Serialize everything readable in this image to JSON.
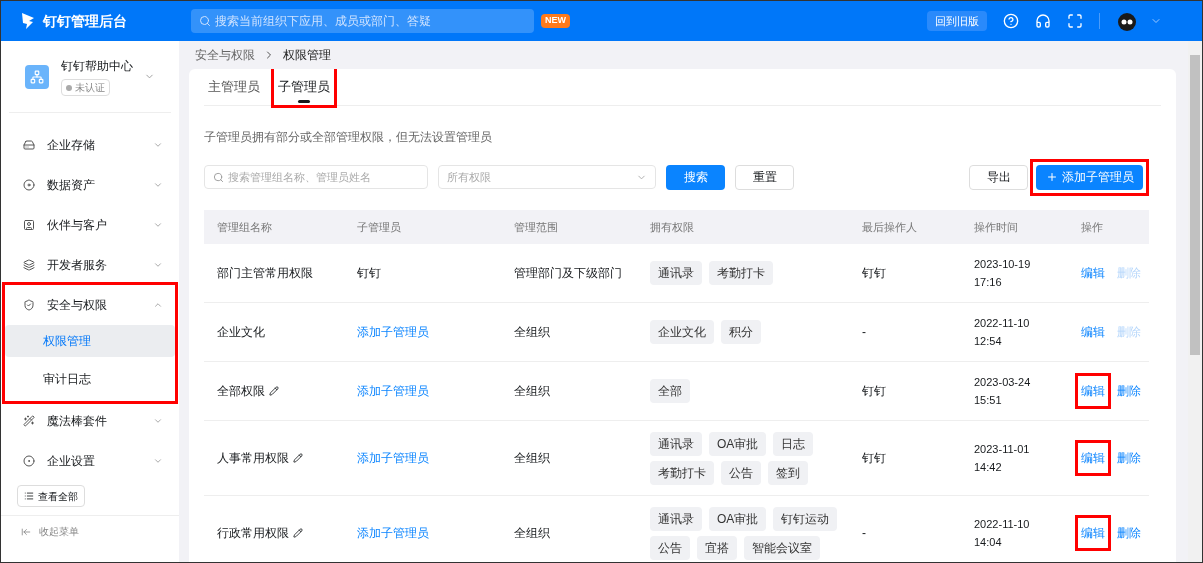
{
  "header": {
    "title": "钉钉管理后台",
    "search_placeholder": "搜索当前组织下应用、成员或部门、答疑",
    "badge": "NEW",
    "old_version_button": "回到旧版"
  },
  "org": {
    "name": "钉钉帮助中心",
    "status": "未认证"
  },
  "sidebar": {
    "items": [
      {
        "label": "企业存储",
        "expanded": false,
        "highlighted": false
      },
      {
        "label": "数据资产",
        "expanded": false,
        "highlighted": false
      },
      {
        "label": "伙伴与客户",
        "expanded": false,
        "highlighted": false
      },
      {
        "label": "开发者服务",
        "expanded": false,
        "highlighted": false
      },
      {
        "label": "安全与权限",
        "expanded": true,
        "highlighted": true,
        "children": [
          {
            "label": "权限管理",
            "selected": true
          },
          {
            "label": "审计日志",
            "selected": false
          }
        ]
      },
      {
        "label": "魔法棒套件",
        "expanded": false,
        "highlighted": false
      },
      {
        "label": "企业设置",
        "expanded": false,
        "highlighted": false
      }
    ],
    "view_all": "查看全部",
    "collapse": "收起菜单"
  },
  "breadcrumb": [
    "安全与权限",
    "权限管理"
  ],
  "tabs": [
    {
      "label": "主管理员",
      "selected": false,
      "highlighted": false
    },
    {
      "label": "子管理员",
      "selected": true,
      "highlighted": true
    }
  ],
  "description": "子管理员拥有部分或全部管理权限，但无法设置管理员",
  "filters": {
    "search_placeholder": "搜索管理组名称、管理员姓名",
    "select_placeholder": "所有权限",
    "search_button": "搜索",
    "reset_button": "重置",
    "export_button": "导出",
    "add_button": {
      "label": "添加子管理员",
      "highlighted": true
    }
  },
  "table": {
    "columns": [
      "管理组名称",
      "子管理员",
      "管理范围",
      "拥有权限",
      "最后操作人",
      "操作时间",
      "操作"
    ],
    "rows": [
      {
        "name": "部门主管常用权限",
        "editable": false,
        "admin": "钉钉",
        "admin_is_link": false,
        "scope": "管理部门及下级部门",
        "permissions": [
          "通讯录",
          "考勤打卡"
        ],
        "operator": "钉钉",
        "time": [
          "2023-10-19",
          "17:16"
        ],
        "edit": "编辑",
        "edit_highlighted": false,
        "delete": "删除",
        "delete_disabled": true
      },
      {
        "name": "企业文化",
        "editable": false,
        "admin": "添加子管理员",
        "admin_is_link": true,
        "scope": "全组织",
        "permissions": [
          "企业文化",
          "积分"
        ],
        "operator": "-",
        "time": [
          "2022-11-10",
          "12:54"
        ],
        "edit": "编辑",
        "edit_highlighted": false,
        "delete": "删除",
        "delete_disabled": true
      },
      {
        "name": "全部权限",
        "editable": true,
        "admin": "添加子管理员",
        "admin_is_link": true,
        "scope": "全组织",
        "permissions": [
          "全部"
        ],
        "operator": "钉钉",
        "time": [
          "2023-03-24",
          "15:51"
        ],
        "edit": "编辑",
        "edit_highlighted": true,
        "delete": "删除",
        "delete_disabled": false
      },
      {
        "name": "人事常用权限",
        "editable": true,
        "admin": "添加子管理员",
        "admin_is_link": true,
        "scope": "全组织",
        "permissions": [
          "通讯录",
          "OA审批",
          "日志",
          "考勤打卡",
          "公告",
          "签到"
        ],
        "operator": "钉钉",
        "time": [
          "2023-11-01",
          "14:42"
        ],
        "edit": "编辑",
        "edit_highlighted": true,
        "delete": "删除",
        "delete_disabled": false
      },
      {
        "name": "行政常用权限",
        "editable": true,
        "admin": "添加子管理员",
        "admin_is_link": true,
        "scope": "全组织",
        "permissions": [
          "通讯录",
          "OA审批",
          "钉钉运动",
          "公告",
          "宜搭",
          "智能会议室"
        ],
        "operator": "-",
        "time": [
          "2022-11-10",
          "14:04"
        ],
        "edit": "编辑",
        "edit_highlighted": true,
        "delete": "删除",
        "delete_disabled": false
      }
    ]
  }
}
